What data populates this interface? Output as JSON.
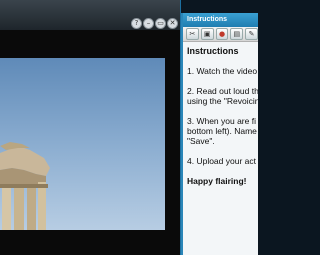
{
  "video_window": {
    "controls": [
      "?",
      "–",
      "▭",
      "✕"
    ]
  },
  "panel": {
    "title": "Instructions",
    "toolbar": [
      "✂",
      "▣",
      "●",
      "▤",
      "✎"
    ],
    "heading": "Instructions",
    "steps": [
      {
        "line1": "1. Watch the video",
        "line2": ""
      },
      {
        "line1": "2. Read out loud th",
        "line2": "using the \"Revoicin"
      },
      {
        "line1": "3. When you are fi",
        "line2": "bottom left). Name",
        "line3": "\"Save\"."
      },
      {
        "line1": "4. Upload your act",
        "line2": ""
      }
    ],
    "closing": "Happy flairing!"
  }
}
